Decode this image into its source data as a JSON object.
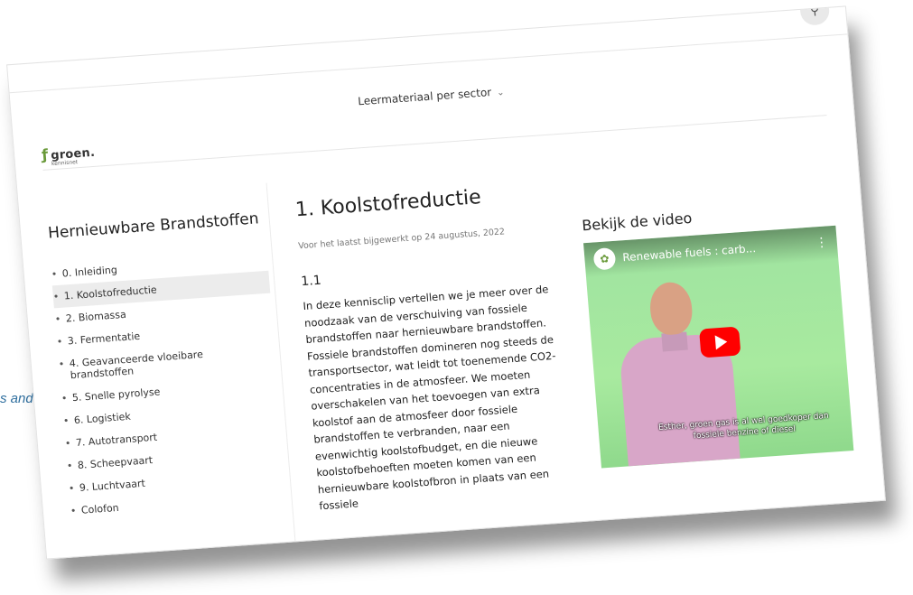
{
  "background_text": "s and",
  "header": {
    "nav_label": "Leermateriaal per sector",
    "logo_word": "groen.",
    "logo_sub": "kennisnet",
    "search_icon": "search-icon"
  },
  "sidebar": {
    "title": "Hernieuwbare Brandstoffen",
    "items": [
      {
        "label": "0. Inleiding"
      },
      {
        "label": "1. Koolstofreductie",
        "active": true
      },
      {
        "label": "2. Biomassa"
      },
      {
        "label": "3. Fermentatie"
      },
      {
        "label": "4. Geavanceerde vloeibare brandstoffen"
      },
      {
        "label": "5. Snelle pyrolyse"
      },
      {
        "label": "6. Logistiek"
      },
      {
        "label": "7. Autotransport"
      },
      {
        "label": "8. Scheepvaart"
      },
      {
        "label": "9. Luchtvaart"
      },
      {
        "label": "Colofon"
      }
    ]
  },
  "main": {
    "title": "1. Koolstofreductie",
    "updated": "Voor het laatst bijgewerkt op 24 augustus, 2022",
    "section": "1.1",
    "body": "In deze kennisclip vertellen we je meer over de noodzaak van de verschuiving van fossiele brandstoffen naar hernieuwbare brandstoffen. Fossiele brandstoffen domineren nog steeds de transportsector, wat leidt tot toenemende CO2-concentraties in de atmosfeer. We moeten overschakelen van het toevoegen van extra koolstof aan de atmosfeer door fossiele brandstoffen te verbranden, naar een evenwichtig koolstofbudget, en die nieuwe koolstofbehoeften moeten komen van een hernieuwbare koolstofbron in plaats van een fossiele"
  },
  "video": {
    "heading": "Bekijk de video",
    "title": "Renewable fuels : carb...",
    "caption": "Esther, groen gas is al wel goedkoper dan fossiele benzine of diesel",
    "accent": "#ff0000"
  }
}
